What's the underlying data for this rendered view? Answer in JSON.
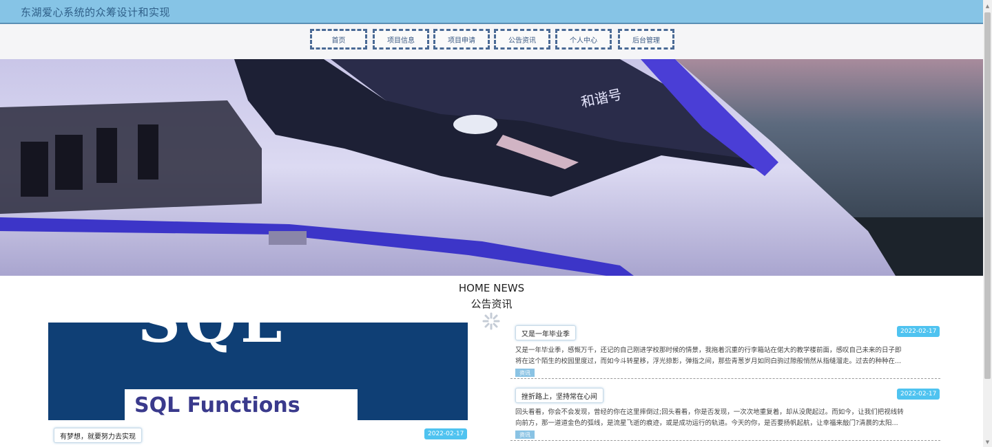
{
  "header": {
    "site_title": "东湖爱心系统的众筹设计和实现"
  },
  "nav": {
    "items": [
      {
        "label": "首页"
      },
      {
        "label": "项目信息"
      },
      {
        "label": "项目申请"
      },
      {
        "label": "公告资讯"
      },
      {
        "label": "个人中心"
      },
      {
        "label": "后台管理"
      }
    ]
  },
  "banner": {
    "carousel": {
      "slide_count": 3,
      "active_index": 0
    },
    "train_sign_text": "和谐号"
  },
  "news_section": {
    "title_en": "HOME NEWS",
    "title_cn": "公告资讯",
    "featured": {
      "image_text_top": "SQL",
      "image_text_bottom": "SQL Functions",
      "title": "有梦想，就要努力去实现",
      "date": "2022-02-17"
    },
    "items": [
      {
        "title": "又是一年毕业季",
        "date": "2022-02-17",
        "line1": "又是一年毕业季，感慨万千，还记的自己刚进学校那时候的情景，我拖着沉重的行李箱站在偌大的教学楼前面，感叹自己未来的日子即",
        "line2": "将在这个陌生的校园里度过，而如今斗转星移，浮光掠影，弹指之间，那些青葱岁月如同白驹过隙般悄然从指缝溜走。过去的种种在...",
        "category": "资讯"
      },
      {
        "title": "挫折路上，坚持常在心间",
        "date": "2022-02-17",
        "line1": "回头看看，你会不会发现，曾经的你在这里摔倒过;回头看看，你是否发现，一次次地重复着，却从没爬起过。而如今，让我们把视线转",
        "line2": "向前方，那一道道金色的弧线，是流星飞逝的痕迹，或是成功运行的轨道。今天的你，是否要扬帆起航，让幸福来敲门?清晨的太阳...",
        "category": "资讯"
      }
    ]
  },
  "colors": {
    "topbar": "#86c4e6",
    "nav_border": "#4a6a95",
    "date_badge": "#4fc3f0",
    "category_badge": "#8ac3e4"
  }
}
